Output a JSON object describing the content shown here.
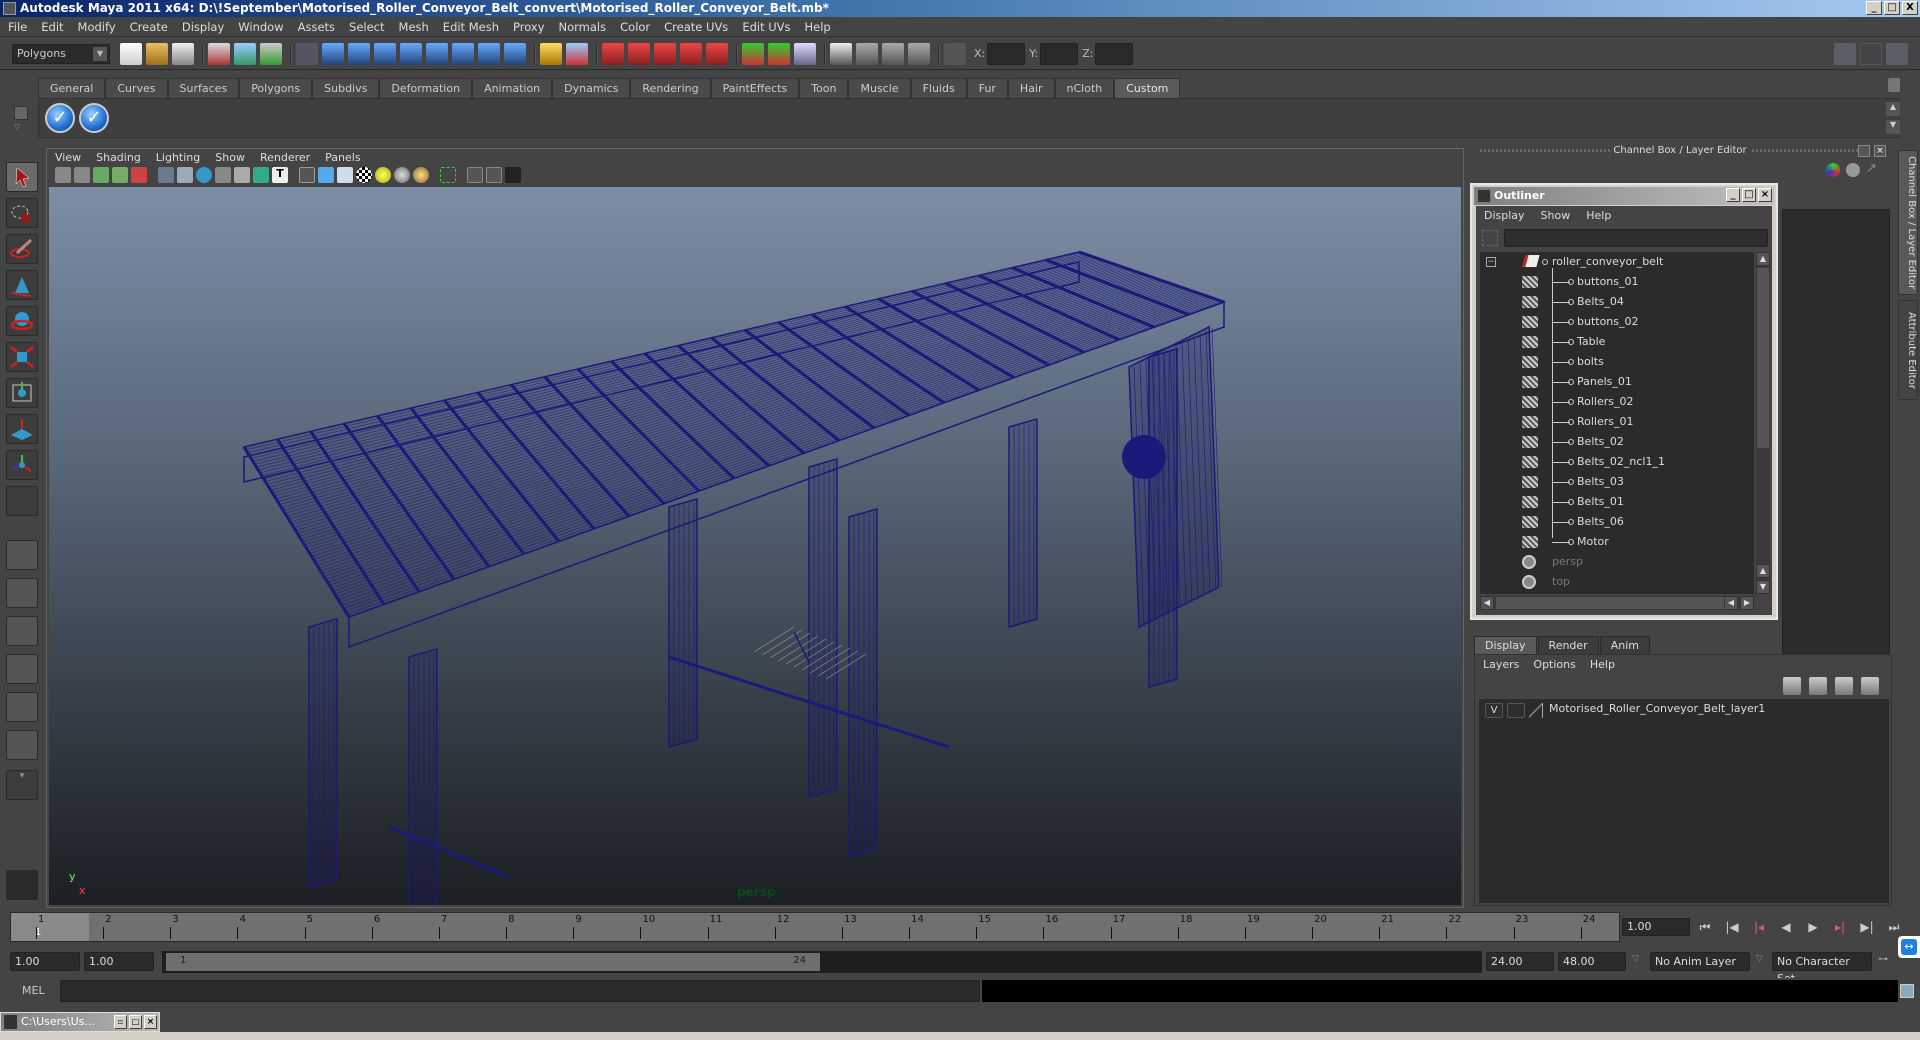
{
  "window": {
    "title": "Autodesk Maya 2011 x64: D:\\!September\\Motorised_Roller_Conveyor_Belt_convert\\Motorised_Roller_Conveyor_Belt.mb*",
    "controls": [
      "_",
      "□",
      "X"
    ]
  },
  "menubar": [
    "File",
    "Edit",
    "Modify",
    "Create",
    "Display",
    "Window",
    "Assets",
    "Select",
    "Mesh",
    "Edit Mesh",
    "Proxy",
    "Normals",
    "Color",
    "Create UVs",
    "Edit UVs",
    "Help"
  ],
  "statusline": {
    "menuset": "Polygons",
    "coords": {
      "x_label": "X:",
      "y_label": "Y:",
      "z_label": "Z:",
      "x": "",
      "y": "",
      "z": ""
    }
  },
  "shelf": {
    "tabs": [
      "General",
      "Curves",
      "Surfaces",
      "Polygons",
      "Subdivs",
      "Deformation",
      "Animation",
      "Dynamics",
      "Rendering",
      "PaintEffects",
      "Toon",
      "Muscle",
      "Fluids",
      "Fur",
      "Hair",
      "nCloth",
      "Custom"
    ],
    "active_tab": "Custom",
    "buttons": [
      "check-button-1",
      "check-button-2"
    ]
  },
  "toolbox": [
    "select-tool",
    "lasso-tool",
    "paint-select-tool",
    "move-tool",
    "rotate-tool",
    "scale-tool",
    "universal-manip-tool",
    "soft-mod-tool",
    "show-manipulator-tool",
    "last-tool"
  ],
  "viewport": {
    "menus": [
      "View",
      "Shading",
      "Lighting",
      "Show",
      "Renderer",
      "Panels"
    ],
    "camera_label": "persp",
    "axis": {
      "x": "x",
      "y": "y"
    },
    "wireframe_color": "#1a1a7a"
  },
  "channel_box": {
    "title": "Channel Box / Layer Editor",
    "side_tabs": [
      "Channel Box / Layer Editor",
      "Attribute Editor"
    ]
  },
  "outliner": {
    "title": "Outliner",
    "menus": [
      "Display",
      "Show",
      "Help"
    ],
    "filter": "",
    "root": "roller_conveyor_belt",
    "children": [
      "buttons_01",
      "Belts_04",
      "buttons_02",
      "Table",
      "bolts",
      "Panels_01",
      "Rollers_02",
      "Rollers_01",
      "Belts_02",
      "Belts_02_ncl1_1",
      "Belts_03",
      "Belts_01",
      "Belts_06",
      "Motor"
    ],
    "cameras": [
      "persp",
      "top"
    ]
  },
  "layer_editor": {
    "tabs": [
      "Display",
      "Render",
      "Anim"
    ],
    "active_tab": "Display",
    "menus": [
      "Layers",
      "Options",
      "Help"
    ],
    "layers": [
      {
        "visible": "V",
        "name": "Motorised_Roller_Conveyor_Belt_layer1"
      }
    ]
  },
  "timeline": {
    "ticks": [
      1,
      2,
      3,
      4,
      5,
      6,
      7,
      8,
      9,
      10,
      11,
      12,
      13,
      14,
      15,
      16,
      17,
      18,
      19,
      20,
      21,
      22,
      23,
      24
    ],
    "current_frame_marker": "1",
    "current_time": "1.00"
  },
  "range": {
    "start_time": "1.00",
    "playback_start": "1.00",
    "range_start_label": "1",
    "range_end_label": "24",
    "playback_end": "24.00",
    "end_time": "48.00",
    "anim_layer": "No Anim Layer",
    "character_set": "No Character Set"
  },
  "command_line": {
    "label": "MEL",
    "input": "",
    "output": ""
  },
  "minimized_window": {
    "title": "C:\\Users\\Us..."
  }
}
